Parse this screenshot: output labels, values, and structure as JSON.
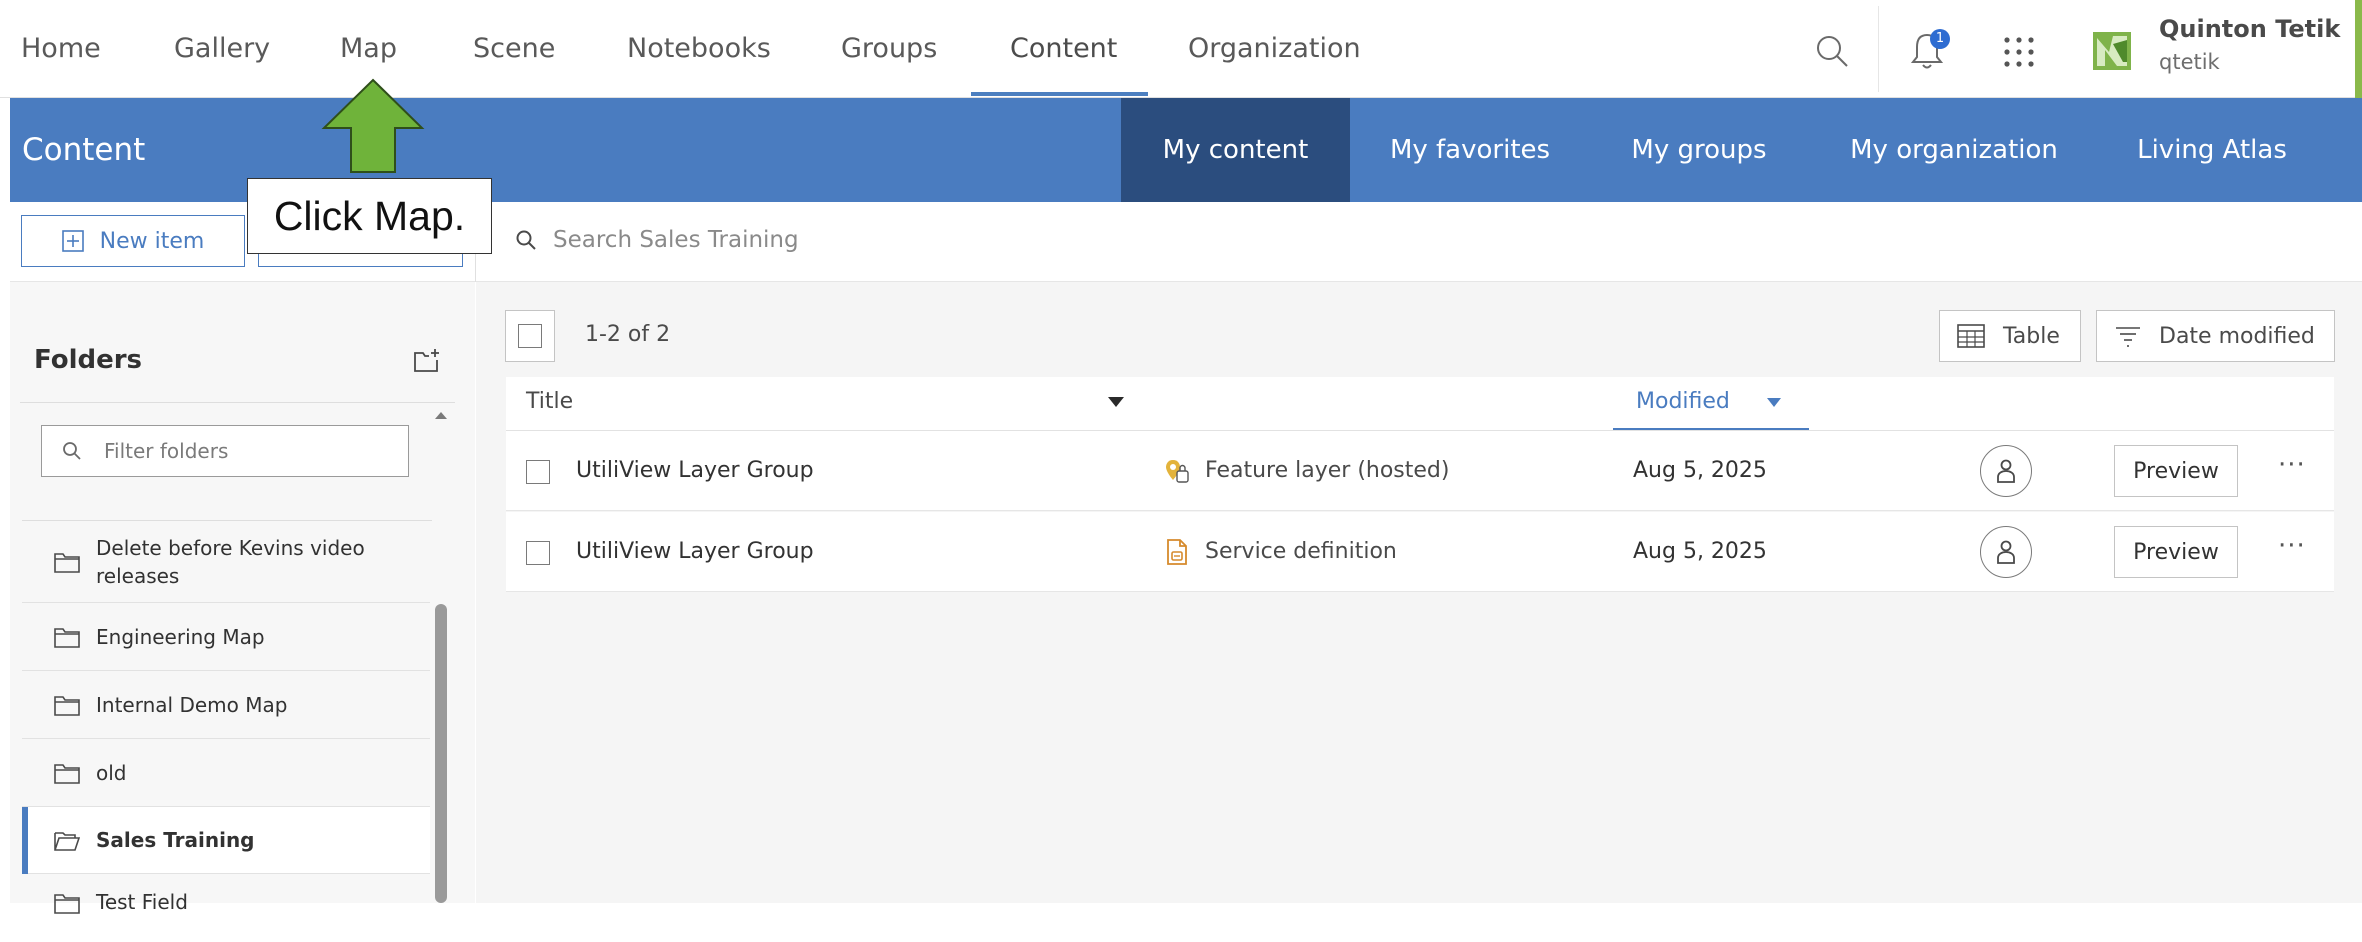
{
  "nav": {
    "items": [
      {
        "label": "Home"
      },
      {
        "label": "Gallery"
      },
      {
        "label": "Map"
      },
      {
        "label": "Scene"
      },
      {
        "label": "Notebooks"
      },
      {
        "label": "Groups"
      },
      {
        "label": "Content"
      },
      {
        "label": "Organization"
      }
    ],
    "active": "Content",
    "notification_count": "1",
    "user": {
      "name": "Quinton Tetik",
      "handle": "qtetik"
    }
  },
  "content_band": {
    "title": "Content",
    "tabs": [
      {
        "label": "My content"
      },
      {
        "label": "My favorites"
      },
      {
        "label": "My groups"
      },
      {
        "label": "My organization"
      },
      {
        "label": "Living Atlas"
      }
    ],
    "active_tab": "My content"
  },
  "toolbar": {
    "new_item_label": "New item",
    "search_placeholder": "Search Sales Training"
  },
  "folders": {
    "title": "Folders",
    "filter_placeholder": "Filter folders",
    "items": [
      {
        "label": "Delete before Kevins video releases"
      },
      {
        "label": "Engineering Map"
      },
      {
        "label": "Internal Demo Map"
      },
      {
        "label": "old"
      },
      {
        "label": "Sales Training"
      },
      {
        "label": "Test Field"
      }
    ],
    "selected": "Sales Training"
  },
  "results": {
    "count_text": "1-2 of 2",
    "view_label": "Table",
    "sort_label": "Date modified",
    "columns": {
      "title": "Title",
      "modified": "Modified"
    },
    "rows": [
      {
        "title": "UtiliView Layer Group",
        "type": "Feature layer (hosted)",
        "modified": "Aug 5, 2025",
        "action": "Preview"
      },
      {
        "title": "UtiliView Layer Group",
        "type": "Service definition",
        "modified": "Aug 5, 2025",
        "action": "Preview"
      }
    ]
  },
  "callout": {
    "text": "Click Map."
  },
  "colors": {
    "brand_blue": "#4a7cc0",
    "active_tab": "#2b4d7e",
    "arrow_green": "#6fb33a"
  }
}
